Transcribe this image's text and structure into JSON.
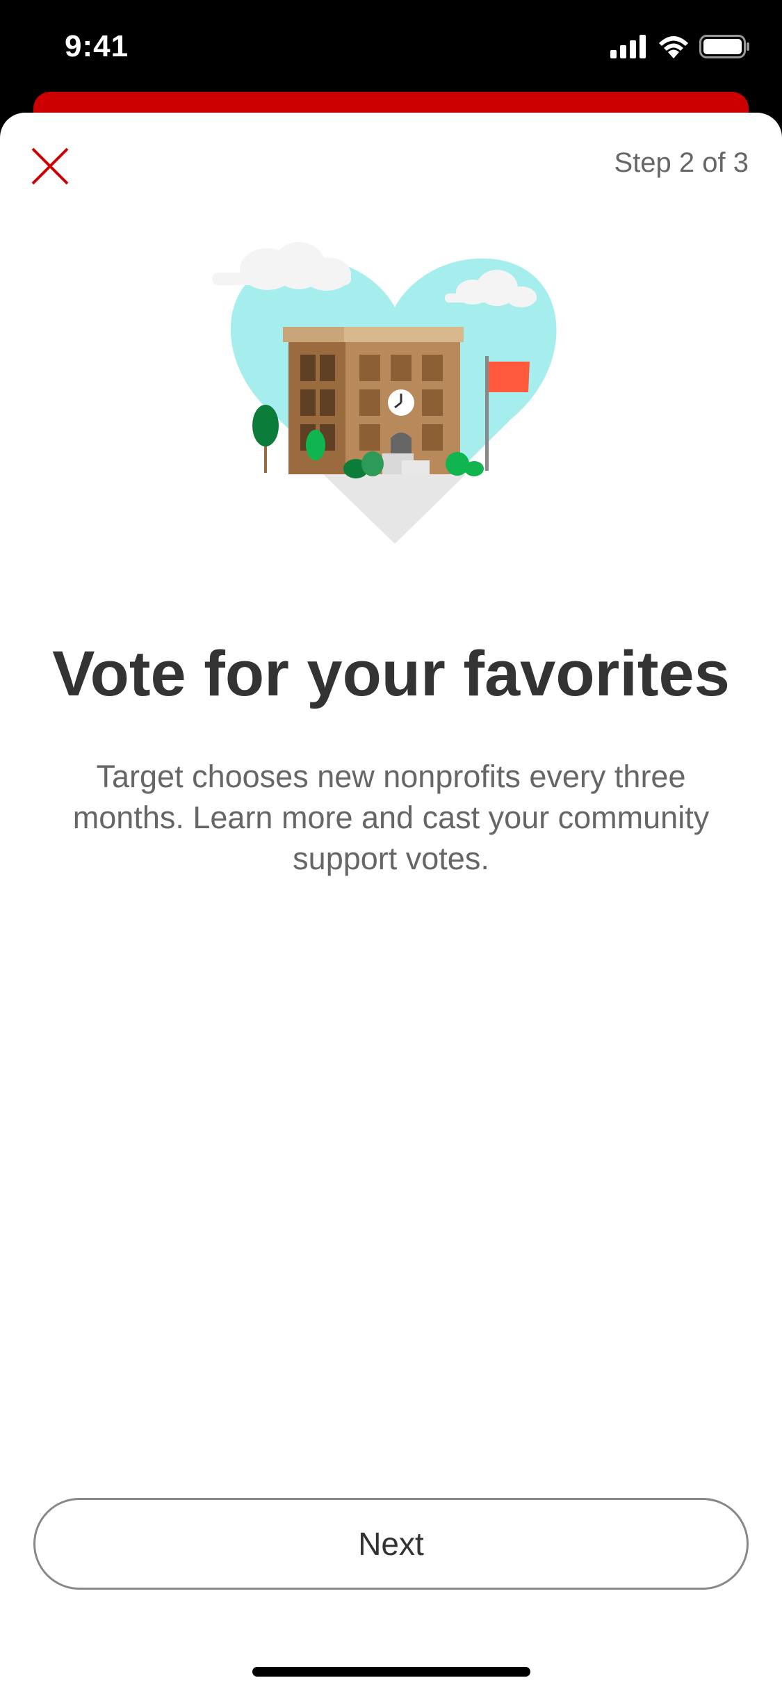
{
  "status_bar": {
    "time": "9:41",
    "icons": [
      "cellular-signal-icon",
      "wifi-icon",
      "battery-icon"
    ]
  },
  "header": {
    "close_icon": "close-icon",
    "step_label": "Step 2 of 3"
  },
  "content": {
    "illustration": "school-building-heart-illustration",
    "headline": "Vote for your favorites",
    "body": "Target chooses new nonprofits every three months. Learn more and cast your community support votes."
  },
  "footer": {
    "next_label": "Next"
  },
  "colors": {
    "accent": "#cc0000",
    "heart": "#a6eeee",
    "text_primary": "#333333",
    "text_secondary": "#666666"
  }
}
